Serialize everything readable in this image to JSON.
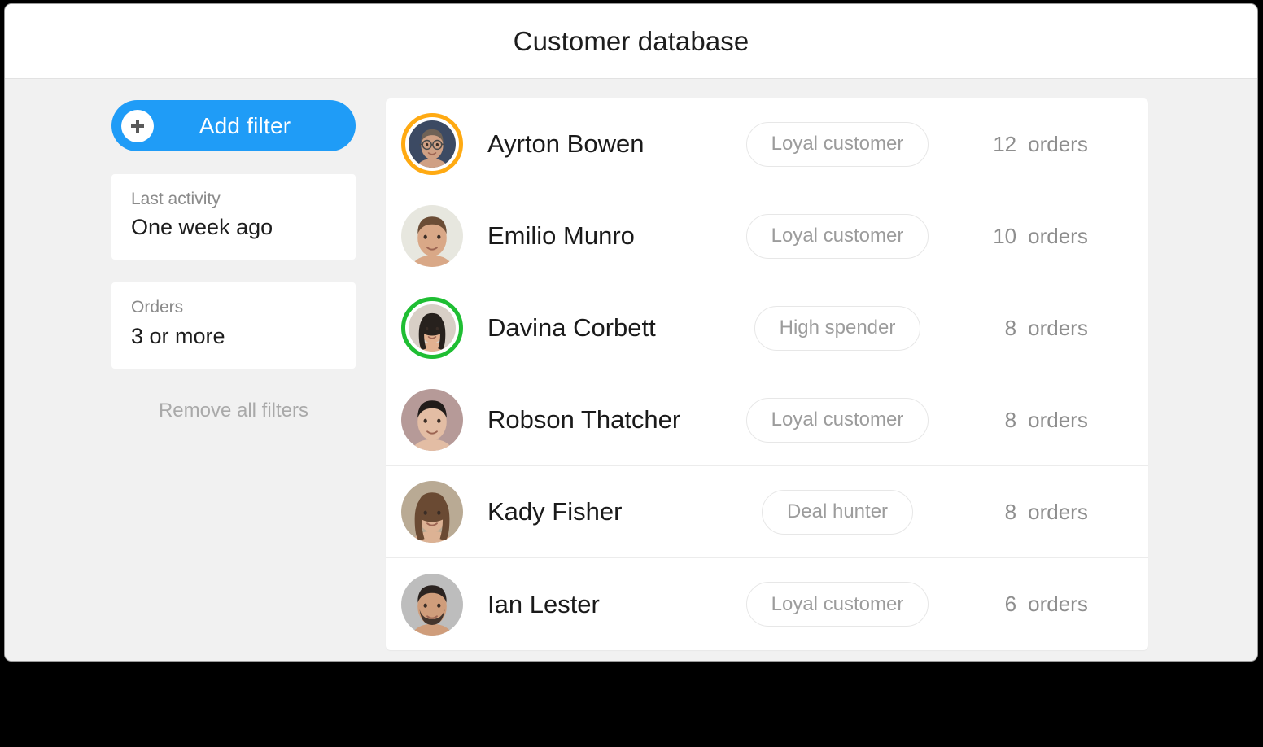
{
  "window": {
    "title": "Customer database"
  },
  "sidebar": {
    "add_filter": {
      "label": "Add filter",
      "icon": "plus-icon",
      "color": "#1f9cf7"
    },
    "filters": [
      {
        "label": "Last activity",
        "value": "One week ago"
      },
      {
        "label": "Orders",
        "value": "3 or more"
      }
    ],
    "remove_all_label": "Remove all filters"
  },
  "list": {
    "orders_word": "orders",
    "rows": [
      {
        "name": "Ayrton Bowen",
        "badge": "Loyal customer",
        "orders": "12",
        "ring": "#FFAA12",
        "avatar": "man-glasses-avatar"
      },
      {
        "name": "Emilio Munro",
        "badge": "Loyal customer",
        "orders": "10",
        "ring": "",
        "avatar": "young-man-avatar"
      },
      {
        "name": "Davina Corbett",
        "badge": "High spender",
        "orders": "8",
        "ring": "#1FBE33",
        "avatar": "woman-dark-hair-avatar"
      },
      {
        "name": "Robson Thatcher",
        "badge": "Loyal customer",
        "orders": "8",
        "ring": "",
        "avatar": "boy-avatar"
      },
      {
        "name": "Kady Fisher",
        "badge": "Deal hunter",
        "orders": "8",
        "ring": "",
        "avatar": "girl-avatar"
      },
      {
        "name": "Ian Lester",
        "badge": "Loyal customer",
        "orders": "6",
        "ring": "",
        "avatar": "man-beard-avatar"
      }
    ]
  }
}
